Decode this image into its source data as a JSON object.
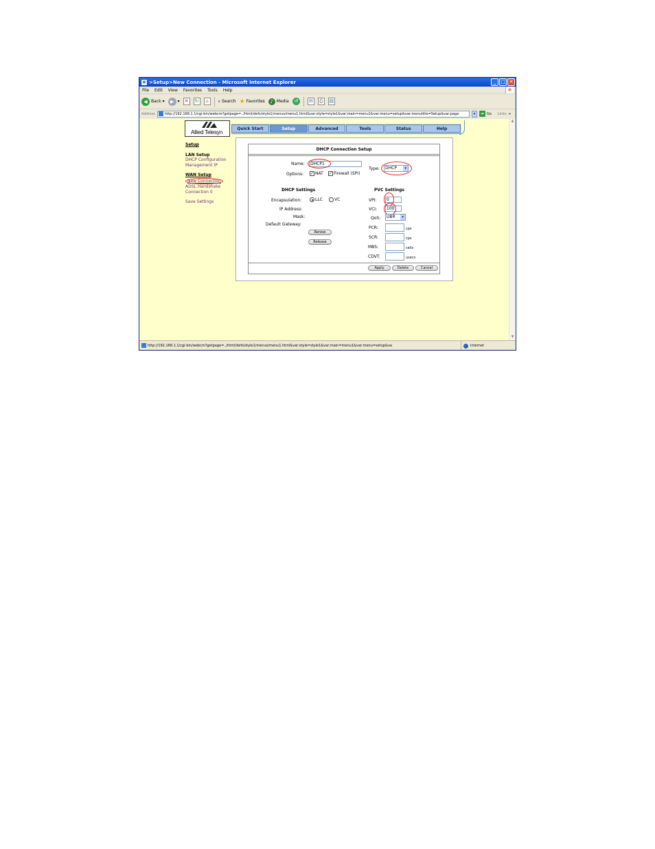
{
  "window": {
    "title": ">Setup>New Connection - Microsoft Internet Explorer",
    "menu": [
      "File",
      "Edit",
      "View",
      "Favorites",
      "Tools",
      "Help"
    ],
    "toolbar": {
      "back": "Back",
      "search": "Search",
      "favorites": "Favorites",
      "media": "Media"
    },
    "address": {
      "label": "Address",
      "url": "http://192.168.1.1/cgi-bin/webcm?getpage=../html/defs/style1/menus/menu1.html&var:style=style1&var:main=menu1&var:menu=setup&var:menutitle=Setup&var:page",
      "go": "Go",
      "links": "Links"
    },
    "status": {
      "text": "http://192.168.1.1/cgi-bin/webcm?getpage=../html/defs/style1/menus/menu1.html&var:style=style1&var:main=menu1&var:menu=setup&va",
      "zone": "Internet"
    }
  },
  "logo": {
    "text": "Allied Telesyn"
  },
  "nav": {
    "tabs": [
      "Quick Start",
      "Setup",
      "Advanced",
      "Tools",
      "Status",
      "Help"
    ],
    "active": "Setup"
  },
  "sidebar": {
    "title": "Setup",
    "lan_header": "LAN Setup",
    "lan_items": [
      "DHCP Configuration",
      "Management IP"
    ],
    "wan_header": "WAN Setup",
    "wan_items": [
      "New Connection",
      "ADSL Handshake",
      "Connection 0"
    ],
    "save": "Save Settings"
  },
  "form": {
    "title": "DHCP Connection Setup",
    "name_label": "Name:",
    "name_value": "DHCP1",
    "type_label": "Type:",
    "type_value": "DHCP",
    "options_label": "Options:",
    "nat_label": "NAT",
    "firewall_label": "Firewall (SPI)",
    "dhcp_settings": {
      "header": "DHCP Settings",
      "encapsulation_label": "Encapsulation:",
      "llc": "LLC",
      "vc": "VC",
      "ip_label": "IP Address:",
      "mask_label": "Mask:",
      "gateway_label": "Default Gateway:",
      "renew": "Renew",
      "release": "Release"
    },
    "pvc_settings": {
      "header": "PVC Settings",
      "vpi_label": "VPI:",
      "vpi_value": "0",
      "vci_label": "VCI:",
      "vci_value": "100",
      "qos_label": "QoS:",
      "qos_value": "UBR",
      "pcr_label": "PCR:",
      "pcr_unit": "cps",
      "scr_label": "SCR:",
      "scr_unit": "cps",
      "mbs_label": "MBS:",
      "mbs_unit": "cells",
      "cdvt_label": "CDVT:",
      "cdvt_unit": "usecs"
    },
    "buttons": {
      "apply": "Apply",
      "delete": "Delete",
      "cancel": "Cancel"
    }
  }
}
